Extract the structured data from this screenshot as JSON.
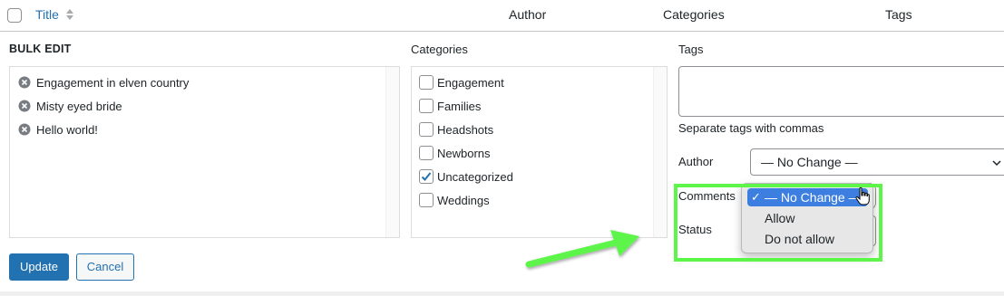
{
  "header": {
    "title": "Title",
    "author": "Author",
    "categories": "Categories",
    "tags": "Tags"
  },
  "bulk_edit": {
    "label": "BULK EDIT",
    "posts": [
      {
        "title": "Engagement in elven country",
        "icon": "remove-icon"
      },
      {
        "title": "Misty eyed bride",
        "icon": "remove-icon"
      },
      {
        "title": "Hello world!",
        "icon": "remove-icon"
      }
    ],
    "categories_label": "Categories",
    "categories": [
      {
        "label": "Engagement",
        "checked": false
      },
      {
        "label": "Families",
        "checked": false
      },
      {
        "label": "Headshots",
        "checked": false
      },
      {
        "label": "Newborns",
        "checked": false
      },
      {
        "label": "Uncategorized",
        "checked": true
      },
      {
        "label": "Weddings",
        "checked": false
      }
    ],
    "tags_label": "Tags",
    "tags_value": "",
    "tags_help": "Separate tags with commas",
    "author_label": "Author",
    "author_value": "— No Change —",
    "comments_label": "Comments",
    "status_label": "Status",
    "comments_dropdown": {
      "options": [
        "— No Change —",
        "Allow",
        "Do not allow"
      ],
      "selected": "— No Change —"
    },
    "update_label": "Update",
    "cancel_label": "Cancel"
  },
  "colors": {
    "link_blue": "#2271b1",
    "selected_option": "#3d7fe0",
    "highlight_green": "#5df54a"
  }
}
